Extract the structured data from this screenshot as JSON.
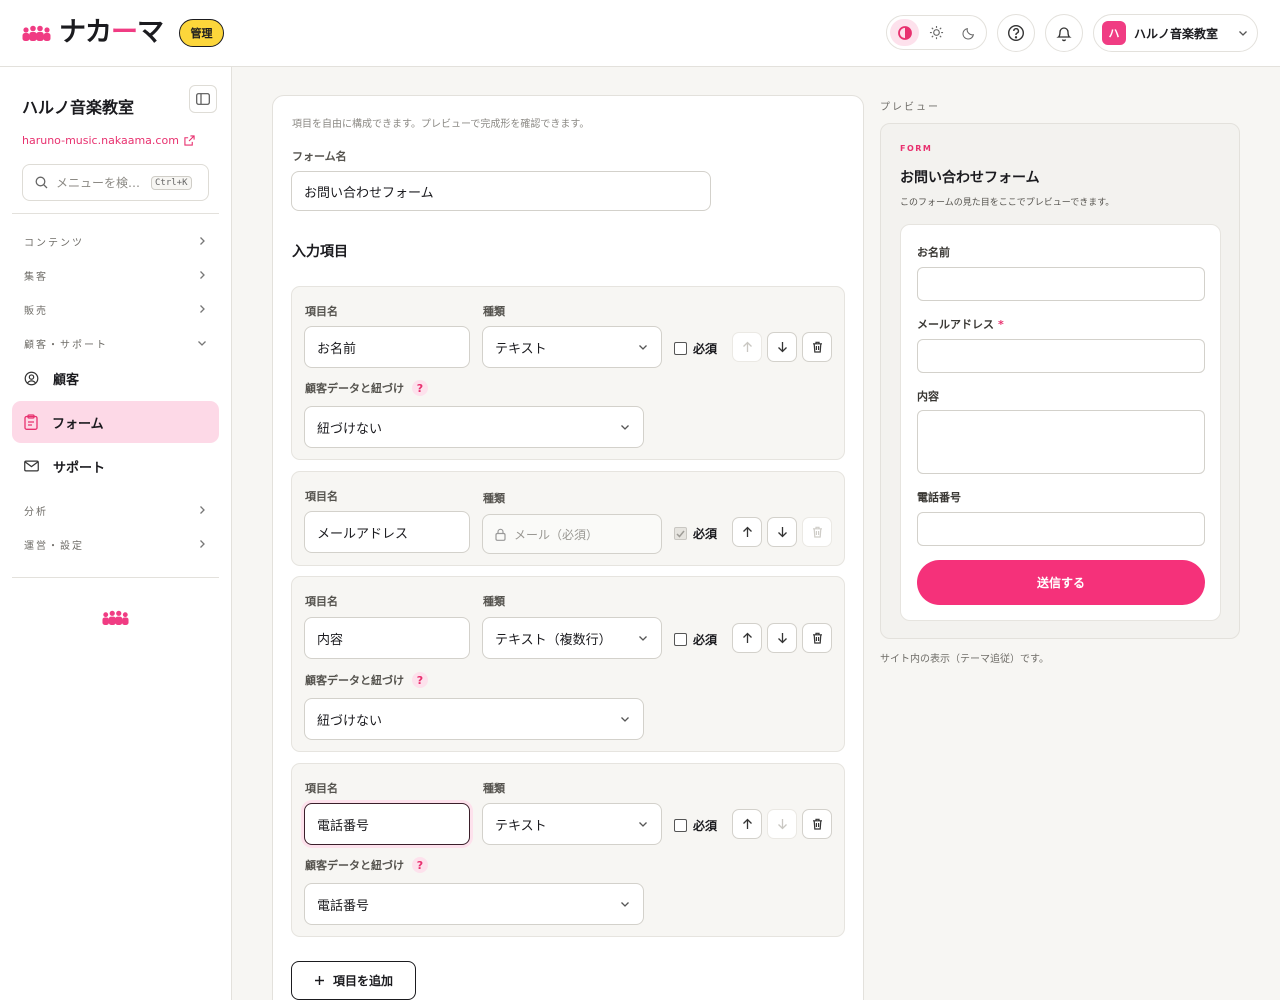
{
  "header": {
    "logo_text": "ナカ",
    "logo_dash": "ー",
    "logo_tail": "マ",
    "admin_badge": "管理",
    "account": {
      "avatar_text": "ハ",
      "name": "ハルノ音楽教室"
    },
    "icons": [
      "people-logo-icon",
      "contrast-icon",
      "sun-icon",
      "moon-icon",
      "help-icon",
      "bell-icon",
      "chevron-down-icon"
    ]
  },
  "sidebar": {
    "site_title": "ハルノ音楽教室",
    "site_url": "haruno-music.nakaama.com",
    "search": {
      "placeholder": "メニューを検…",
      "shortcut": "Ctrl+K"
    },
    "sections": [
      {
        "label": "コンテンツ"
      },
      {
        "label": "集客"
      },
      {
        "label": "販売"
      },
      {
        "label": "顧客・サポート"
      }
    ],
    "items": [
      {
        "label": "顧客",
        "icon": "user-circle-icon"
      },
      {
        "label": "フォーム",
        "icon": "clipboard-icon",
        "active": true
      },
      {
        "label": "サポート",
        "icon": "mail-icon"
      }
    ],
    "sections_bottom": [
      {
        "label": "分析"
      },
      {
        "label": "運営・設定"
      }
    ]
  },
  "editor": {
    "hint": "項目を自由に構成できます。プレビューで完成形を確認できます。",
    "form_name_label": "フォーム名",
    "form_name_value": "お問い合わせフォーム",
    "fields_title": "入力項目",
    "field_name_label": "項目名",
    "type_label": "種類",
    "required_label": "必須",
    "link_label": "顧客データと紐づけ",
    "link_help": "?",
    "fields": [
      {
        "name": "お名前",
        "type": "テキスト",
        "required": false,
        "link": "紐づけない"
      },
      {
        "name": "メールアドレス",
        "type": "メール（必須）",
        "required": true,
        "locked": true
      },
      {
        "name": "内容",
        "type": "テキスト（複数行）",
        "required": false,
        "link": "紐づけない"
      },
      {
        "name": "電話番号",
        "type": "テキスト",
        "required": false,
        "link": "電話番号"
      }
    ],
    "add_button": "項目を追加"
  },
  "preview": {
    "section_label": "プレビュー",
    "eyebrow": "FORM",
    "title": "お問い合わせフォーム",
    "description": "このフォームの見た目をここでプレビューできます。",
    "fields": [
      {
        "label": "お名前",
        "required": false
      },
      {
        "label": "メールアドレス",
        "required": true
      },
      {
        "label": "内容",
        "required": false
      },
      {
        "label": "電話番号",
        "required": false
      }
    ],
    "required_mark": "*",
    "submit": "送信する",
    "note": "サイト内の表示（テーマ追従）です。"
  },
  "colors": {
    "brand": "#f03c83",
    "badge": "#fcd63b",
    "active_nav": "#fdd9e7",
    "submit": "#f5317a"
  }
}
